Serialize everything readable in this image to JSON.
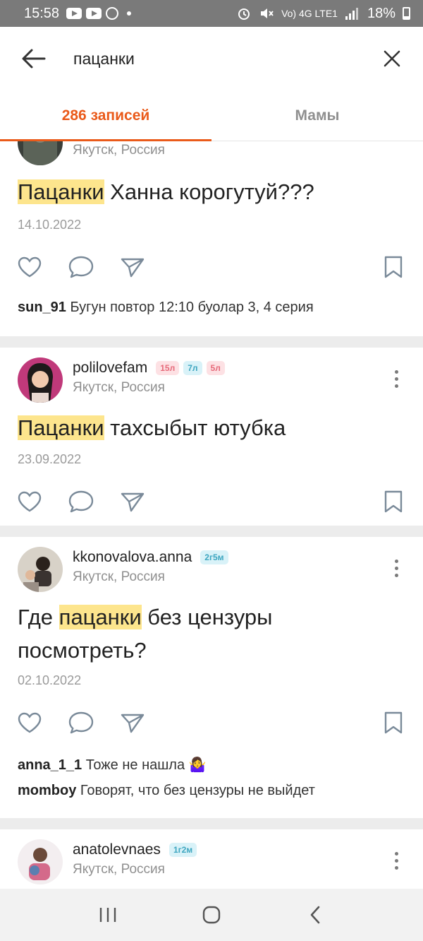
{
  "status_bar": {
    "time": "15:58",
    "network_text": "Vo) 4G LTE1",
    "battery": "18%"
  },
  "search": {
    "query": "пацанки"
  },
  "tabs": [
    {
      "label": "286 записей",
      "active": true
    },
    {
      "label": "Мамы",
      "active": false
    }
  ],
  "posts": [
    {
      "username": "",
      "badges": [],
      "location": "Якутск, Россия",
      "text_before": "",
      "highlight": "Пацанки",
      "text_after": " Ханна корогутуй???",
      "date": "14.10.2022",
      "comments": [
        {
          "user": "sun_91",
          "text": "Бугун повтор 12:10 буолар 3, 4 серия"
        }
      ]
    },
    {
      "username": "polilovefam",
      "badges": [
        "15л",
        "7л",
        "5л"
      ],
      "location": "Якутск, Россия",
      "text_before": "",
      "highlight": "Пацанки",
      "text_after": " тахсыбыт ютубка",
      "date": "23.09.2022",
      "comments": []
    },
    {
      "username": "kkonovalova.anna",
      "badges": [
        "2г5м"
      ],
      "location": "Якутск, Россия",
      "text_before": "Где ",
      "highlight": "пацанки",
      "text_after": " без цензуры посмотреть?",
      "date": "02.10.2022",
      "comments": [
        {
          "user": "anna_1_1",
          "text": "Тоже не нашла 🤷‍♀️"
        },
        {
          "user": "momboy",
          "text": "Говорят, что без цензуры не выйдет"
        }
      ]
    },
    {
      "username": "anatolevnaes",
      "badges": [
        "1г2м"
      ],
      "location": "Якутск, Россия"
    }
  ],
  "colors": {
    "accent": "#ea5a1a",
    "highlight": "#fde58d"
  }
}
